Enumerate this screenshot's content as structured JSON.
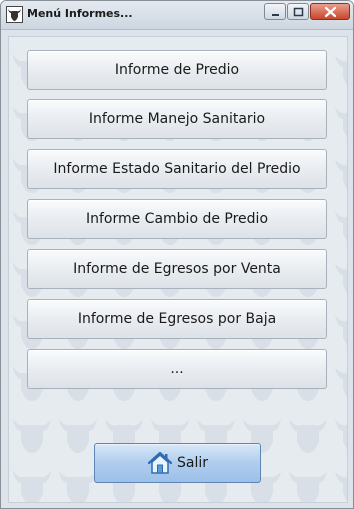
{
  "window": {
    "title": "Menú Informes..."
  },
  "menu": {
    "items": [
      {
        "label": "Informe de Predio"
      },
      {
        "label": "Informe Manejo Sanitario"
      },
      {
        "label": "Informe Estado Sanitario del Predio"
      },
      {
        "label": "Informe Cambio de Predio"
      },
      {
        "label": "Informe de Egresos por Venta"
      },
      {
        "label": "Informe de Egresos por Baja"
      },
      {
        "label": "..."
      }
    ]
  },
  "footer": {
    "exit_label": "Salir",
    "exit_icon": "home-icon"
  },
  "colors": {
    "background": "#e6ebf0",
    "exit_button": "#b0cdee",
    "close_button": "#c9462c"
  }
}
